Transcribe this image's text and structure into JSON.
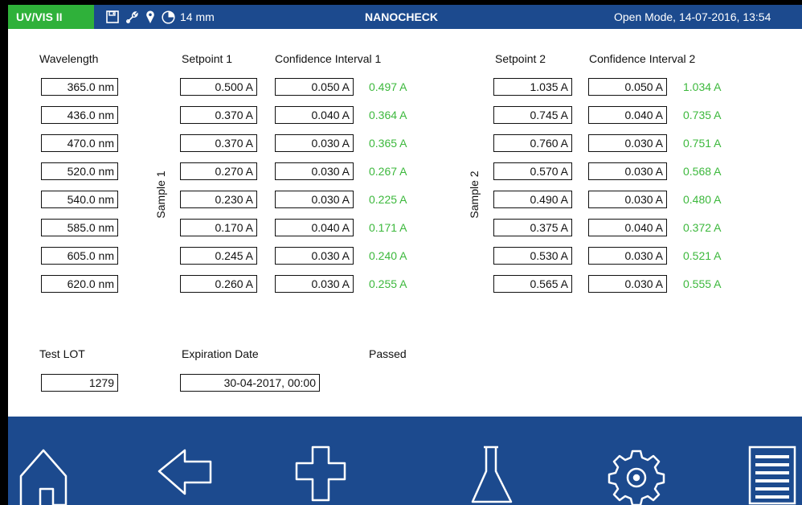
{
  "topbar": {
    "mode": "UV/VIS II",
    "depth": "14 mm",
    "app_title": "NANOCHECK",
    "datetime": "Open Mode, 14-07-2016, 13:54",
    "icons": [
      "save-icon",
      "wrench-icon",
      "location-pin-icon",
      "pie-clock-icon"
    ]
  },
  "headers": {
    "wavelength": "Wavelength",
    "setpoint1": "Setpoint 1",
    "ci1": "Confidence Interval 1",
    "setpoint2": "Setpoint 2",
    "ci2": "Confidence Interval 2"
  },
  "sample1_label": "Sample 1",
  "sample2_label": "Sample 2",
  "rows": [
    {
      "wl": "365.0 nm",
      "sp1": "0.500 A",
      "ci1": "0.050 A",
      "r1": "0.497 A",
      "sp2": "1.035 A",
      "ci2": "0.050 A",
      "r2": "1.034 A"
    },
    {
      "wl": "436.0 nm",
      "sp1": "0.370 A",
      "ci1": "0.040 A",
      "r1": "0.364 A",
      "sp2": "0.745 A",
      "ci2": "0.040 A",
      "r2": "0.735 A"
    },
    {
      "wl": "470.0 nm",
      "sp1": "0.370 A",
      "ci1": "0.030 A",
      "r1": "0.365 A",
      "sp2": "0.760 A",
      "ci2": "0.030 A",
      "r2": "0.751 A"
    },
    {
      "wl": "520.0 nm",
      "sp1": "0.270 A",
      "ci1": "0.030 A",
      "r1": "0.267 A",
      "sp2": "0.570 A",
      "ci2": "0.030 A",
      "r2": "0.568 A"
    },
    {
      "wl": "540.0 nm",
      "sp1": "0.230 A",
      "ci1": "0.030 A",
      "r1": "0.225 A",
      "sp2": "0.490 A",
      "ci2": "0.030 A",
      "r2": "0.480 A"
    },
    {
      "wl": "585.0 nm",
      "sp1": "0.170 A",
      "ci1": "0.040 A",
      "r1": "0.171 A",
      "sp2": "0.375 A",
      "ci2": "0.040 A",
      "r2": "0.372 A"
    },
    {
      "wl": "605.0 nm",
      "sp1": "0.245 A",
      "ci1": "0.030 A",
      "r1": "0.240 A",
      "sp2": "0.530 A",
      "ci2": "0.030 A",
      "r2": "0.521 A"
    },
    {
      "wl": "620.0 nm",
      "sp1": "0.260 A",
      "ci1": "0.030 A",
      "r1": "0.255 A",
      "sp2": "0.565 A",
      "ci2": "0.030 A",
      "r2": "0.555 A"
    }
  ],
  "lot": {
    "test_lot_label": "Test LOT",
    "test_lot_value": "1279",
    "expiration_label": "Expiration Date",
    "expiration_value": "30-04-2017, 00:00",
    "passed_label": "Passed"
  },
  "colors": {
    "bar_blue": "#1c4a8e",
    "mode_green": "#2fb13a",
    "result_green": "#3cb83c"
  },
  "nav": [
    "home-icon",
    "back-arrow-icon",
    "plus-icon",
    "flask-icon",
    "gear-icon",
    "menu-list-icon"
  ]
}
